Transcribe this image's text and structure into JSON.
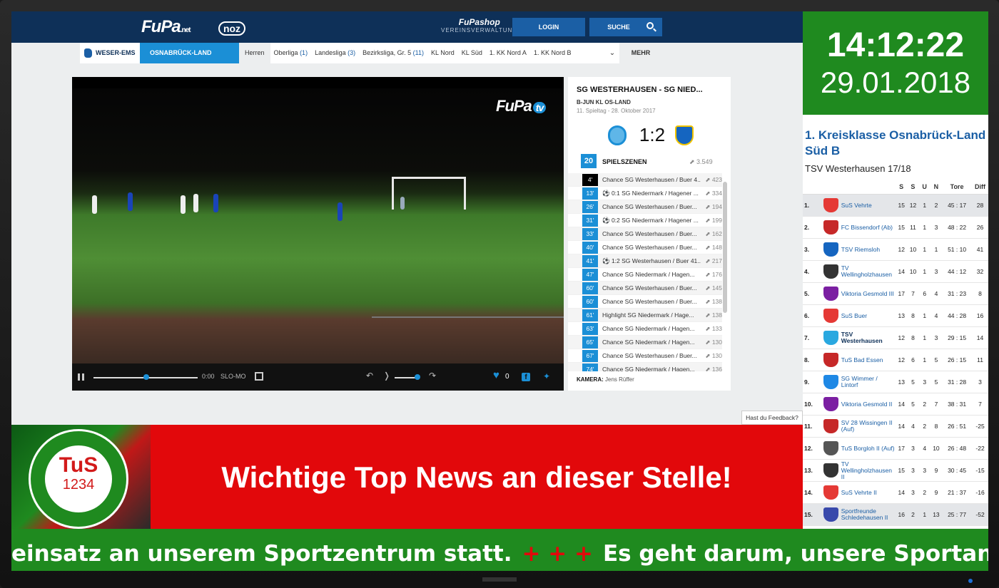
{
  "topbar": {
    "fupa_logo": "FuPa",
    "fupa_net": ".net",
    "noz_logo": "noz",
    "shop_title": "FuPashop",
    "shop_sub": "VEREINSVERWALTUNG",
    "login": "LOGIN",
    "search": "SUCHE"
  },
  "nav": {
    "region": "WESER-EMS",
    "area": "OSNABRÜCK-LAND",
    "more": "MEHR",
    "leagues": [
      {
        "label": "Herren",
        "count": ""
      },
      {
        "label": "Oberliga",
        "count": "(1)"
      },
      {
        "label": "Landesliga",
        "count": "(3)"
      },
      {
        "label": "Bezirksliga, Gr. 5",
        "count": "(11)"
      },
      {
        "label": "KL Nord",
        "count": ""
      },
      {
        "label": "KL Süd",
        "count": ""
      },
      {
        "label": "1. KK Nord A",
        "count": ""
      },
      {
        "label": "1. KK Nord B",
        "count": ""
      }
    ]
  },
  "video": {
    "brand": "FuPa",
    "brand_tv": "tv",
    "time": "0:00",
    "slomo": "SLO-MO",
    "likes": "0"
  },
  "match": {
    "title": "SG WESTERHAUSEN - SG NIED...",
    "league": "B-JUN KL OS-LAND",
    "date": "11. Spieltag - 28. Oktober 2017",
    "score": "1:2",
    "scenes_count": "20",
    "scenes_label": "SPIELSZENEN",
    "scenes_views": "3.549",
    "camera_label": "KAMERA:",
    "camera_name": "Jens Rüffer",
    "scenes": [
      {
        "min": "4'",
        "text": "Chance SG Westerhausen / Buer 4...",
        "views": "423"
      },
      {
        "min": "13'",
        "text": "⚽ 0:1 SG Niedermark / Hagener ...",
        "views": "334"
      },
      {
        "min": "26'",
        "text": "Chance SG Westerhausen / Buer...",
        "views": "194"
      },
      {
        "min": "31'",
        "text": "⚽ 0:2 SG Niedermark / Hagener ...",
        "views": "199"
      },
      {
        "min": "33'",
        "text": "Chance SG Westerhausen / Buer...",
        "views": "162"
      },
      {
        "min": "40'",
        "text": "Chance SG Westerhausen / Buer...",
        "views": "148"
      },
      {
        "min": "41'",
        "text": "⚽ 1:2 SG Westerhausen / Buer 41...",
        "views": "217"
      },
      {
        "min": "47'",
        "text": "Chance SG Niedermark / Hagen...",
        "views": "176"
      },
      {
        "min": "60'",
        "text": "Chance SG Westerhausen / Buer...",
        "views": "145"
      },
      {
        "min": "60'",
        "text": "Chance SG Westerhausen / Buer...",
        "views": "138"
      },
      {
        "min": "61'",
        "text": "Highlight SG Niedermark / Hage...",
        "views": "138"
      },
      {
        "min": "63'",
        "text": "Chance SG Niedermark / Hagen...",
        "views": "133"
      },
      {
        "min": "65'",
        "text": "Chance SG Niedermark / Hagen...",
        "views": "130"
      },
      {
        "min": "67'",
        "text": "Chance SG Westerhausen / Buer...",
        "views": "130"
      },
      {
        "min": "74'",
        "text": "Chance SG Niedermark / Hagen...",
        "views": "136"
      }
    ]
  },
  "feedback": "Hast du Feedback?",
  "clock": {
    "time": "14:12:22",
    "date": "29.01.2018"
  },
  "table": {
    "title": "1. Kreisklasse Osnabrück-Land Süd B",
    "subtitle": "TSV Westerhausen 17/18",
    "headers": [
      "S",
      "S",
      "U",
      "N",
      "Tore",
      "Diff"
    ],
    "rows": [
      {
        "rank": "1.",
        "team": "SuS Vehrte",
        "s": "15",
        "w": "12",
        "d": "1",
        "l": "2",
        "tore": "45 : 17",
        "diff": "28",
        "color": "#e53935"
      },
      {
        "rank": "2.",
        "team": "FC Bissendorf (Ab)",
        "s": "15",
        "w": "11",
        "d": "1",
        "l": "3",
        "tore": "48 : 22",
        "diff": "26",
        "color": "#c62828"
      },
      {
        "rank": "3.",
        "team": "TSV Riemsloh",
        "s": "12",
        "w": "10",
        "d": "1",
        "l": "1",
        "tore": "51 : 10",
        "diff": "41",
        "color": "#1565c0"
      },
      {
        "rank": "4.",
        "team": "TV Wellingholzhausen",
        "s": "14",
        "w": "10",
        "d": "1",
        "l": "3",
        "tore": "44 : 12",
        "diff": "32",
        "color": "#333333"
      },
      {
        "rank": "5.",
        "team": "Viktoria Gesmold III",
        "s": "17",
        "w": "7",
        "d": "6",
        "l": "4",
        "tore": "31 : 23",
        "diff": "8",
        "color": "#7b1fa2"
      },
      {
        "rank": "6.",
        "team": "SuS Buer",
        "s": "13",
        "w": "8",
        "d": "1",
        "l": "4",
        "tore": "44 : 28",
        "diff": "16",
        "color": "#e53935"
      },
      {
        "rank": "7.",
        "team": "TSV Westerhausen",
        "s": "12",
        "w": "8",
        "d": "1",
        "l": "3",
        "tore": "29 : 15",
        "diff": "14",
        "color": "#29a8e0"
      },
      {
        "rank": "8.",
        "team": "TuS Bad Essen",
        "s": "12",
        "w": "6",
        "d": "1",
        "l": "5",
        "tore": "26 : 15",
        "diff": "11",
        "color": "#c62828"
      },
      {
        "rank": "9.",
        "team": "SG Wimmer / Lintorf",
        "s": "13",
        "w": "5",
        "d": "3",
        "l": "5",
        "tore": "31 : 28",
        "diff": "3",
        "color": "#1e88e5"
      },
      {
        "rank": "10.",
        "team": "Viktoria Gesmold II",
        "s": "14",
        "w": "5",
        "d": "2",
        "l": "7",
        "tore": "38 : 31",
        "diff": "7",
        "color": "#7b1fa2"
      },
      {
        "rank": "11.",
        "team": "SV 28 Wissingen II (Auf)",
        "s": "14",
        "w": "4",
        "d": "2",
        "l": "8",
        "tore": "26 : 51",
        "diff": "-25",
        "color": "#c62828"
      },
      {
        "rank": "12.",
        "team": "TuS Borgloh II (Auf)",
        "s": "17",
        "w": "3",
        "d": "4",
        "l": "10",
        "tore": "26 : 48",
        "diff": "-22",
        "color": "#555555"
      },
      {
        "rank": "13.",
        "team": "TV Wellingholzhausen II",
        "s": "15",
        "w": "3",
        "d": "3",
        "l": "9",
        "tore": "30 : 45",
        "diff": "-15",
        "color": "#333333"
      },
      {
        "rank": "14.",
        "team": "SuS Vehrte II",
        "s": "14",
        "w": "3",
        "d": "2",
        "l": "9",
        "tore": "21 : 37",
        "diff": "-16",
        "color": "#e53935"
      },
      {
        "rank": "15.",
        "team": "Sportfreunde Schledehausen II",
        "s": "16",
        "w": "2",
        "d": "1",
        "l": "13",
        "tore": "25 : 77",
        "diff": "-52",
        "color": "#3949ab"
      }
    ]
  },
  "banner": {
    "club_name": "TuS",
    "club_number": "1234",
    "headline": "Wichtige Top News an dieser Stelle!"
  },
  "ticker": {
    "left": "einsatz an unserem Sportzentrum statt.",
    "separator": "+ + +",
    "right": "Es geht darum, unsere Sportanlage \"winte"
  }
}
